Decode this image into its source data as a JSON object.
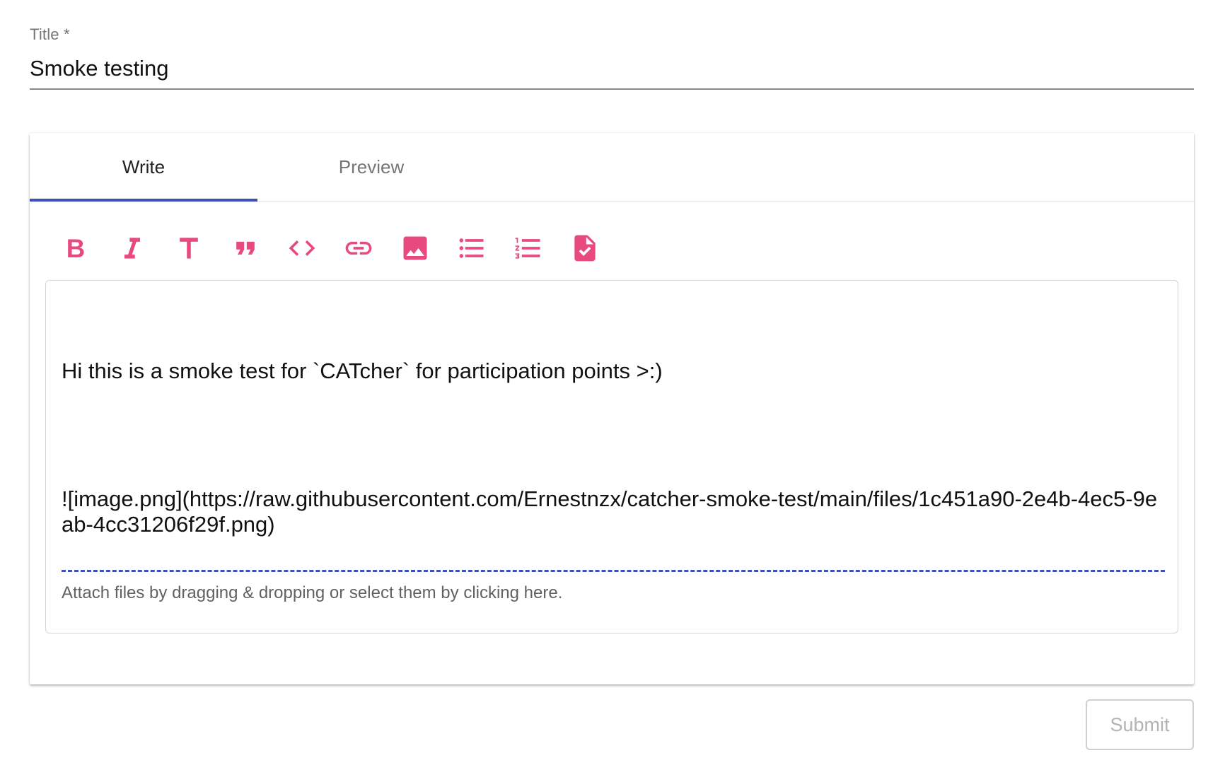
{
  "title_field": {
    "label": "Title *",
    "value": "Smoke testing"
  },
  "tabs": [
    {
      "label": "Write",
      "active": true
    },
    {
      "label": "Preview",
      "active": false
    }
  ],
  "toolbar": {
    "icon_color": "#e84a7f",
    "icons": [
      "bold-icon",
      "italic-icon",
      "heading-icon",
      "quote-icon",
      "code-icon",
      "link-icon",
      "image-icon",
      "bulleted-list-icon",
      "numbered-list-icon",
      "task-list-icon"
    ]
  },
  "editor": {
    "line1": "Hi this is a smoke test for `CATcher` for participation points >:)",
    "line2": "![image.png](https://raw.githubusercontent.com/Ernestnzx/catcher-smoke-test/main/files/1c451a90-2e4b-4ec5-9eab-4cc31206f29f.png)",
    "attach_hint": "Attach files by dragging & dropping or select them by clicking here."
  },
  "submit": {
    "label": "Submit",
    "disabled": true
  },
  "colors": {
    "accent": "#3f51b5",
    "icon": "#e84a7f"
  }
}
